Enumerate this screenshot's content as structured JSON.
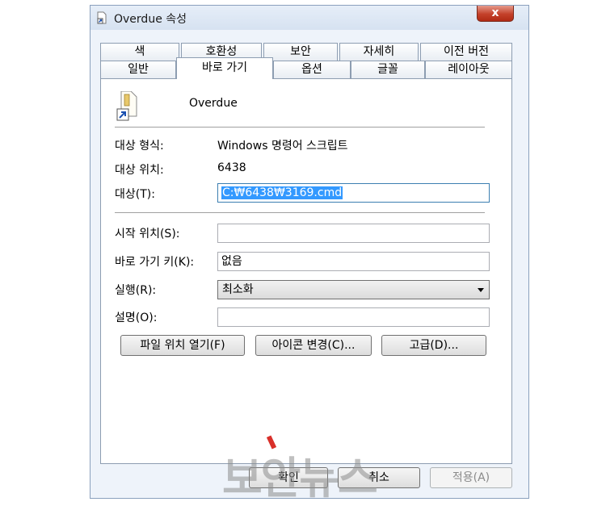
{
  "window": {
    "title": "Overdue 속성",
    "close_label": "x"
  },
  "tabs_row1": [
    {
      "label": "색"
    },
    {
      "label": "호환성"
    },
    {
      "label": "보안"
    },
    {
      "label": "자세히"
    },
    {
      "label": "이전 버전"
    }
  ],
  "tabs_row2": [
    {
      "label": "일반"
    },
    {
      "label": "바로 가기",
      "active": true
    },
    {
      "label": "옵션"
    },
    {
      "label": "글꼴"
    },
    {
      "label": "레이아웃"
    }
  ],
  "shortcut": {
    "name": "Overdue",
    "target_type_label": "대상 형식:",
    "target_type_value": "Windows 명령어 스크립트",
    "target_location_label": "대상 위치:",
    "target_location_value": "6438",
    "target_label": "대상(T):",
    "target_value": "C:₩6438₩3169.cmd",
    "start_in_label": "시작 위치(S):",
    "start_in_value": "",
    "shortcut_key_label": "바로 가기 키(K):",
    "shortcut_key_value": "없음",
    "run_label": "실행(R):",
    "run_value": "최소화",
    "comment_label": "설명(O):",
    "comment_value": ""
  },
  "buttons": {
    "open_location": "파일 위치 열기(F)",
    "change_icon": "아이콘 변경(C)...",
    "advanced": "고급(D)..."
  },
  "footer": {
    "ok": "확인",
    "cancel": "취소",
    "apply": "적용(A)"
  },
  "watermark": "보안뉴스"
}
